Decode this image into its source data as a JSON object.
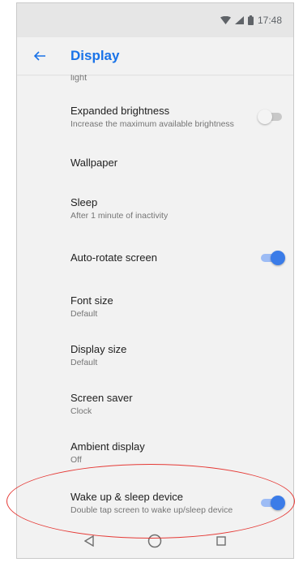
{
  "status_bar": {
    "time": "17:48",
    "icons": [
      "wifi-icon",
      "signal-icon",
      "battery-icon"
    ]
  },
  "app_bar": {
    "title": "Display",
    "back_icon": "arrow-left-icon",
    "accent_color": "#1a73e8"
  },
  "settings": {
    "cut_top": "light",
    "items": [
      {
        "title": "Expanded brightness",
        "subtitle": "Increase the maximum available brightness",
        "toggle": "off"
      },
      {
        "title": "Wallpaper",
        "subtitle": ""
      },
      {
        "title": "Sleep",
        "subtitle": "After 1 minute of inactivity"
      },
      {
        "title": "Auto-rotate screen",
        "subtitle": "",
        "toggle": "on"
      },
      {
        "title": "Font size",
        "subtitle": "Default"
      },
      {
        "title": "Display size",
        "subtitle": "Default"
      },
      {
        "title": "Screen saver",
        "subtitle": "Clock"
      },
      {
        "title": "Ambient display",
        "subtitle": "Off"
      },
      {
        "title": "Wake up & sleep device",
        "subtitle": "Double tap screen to wake up/sleep device",
        "toggle": "on"
      }
    ]
  },
  "nav_bar": {
    "icons": [
      "back-triangle-icon",
      "home-circle-icon",
      "recents-square-icon"
    ]
  },
  "annotation": {
    "color": "#e53935"
  }
}
